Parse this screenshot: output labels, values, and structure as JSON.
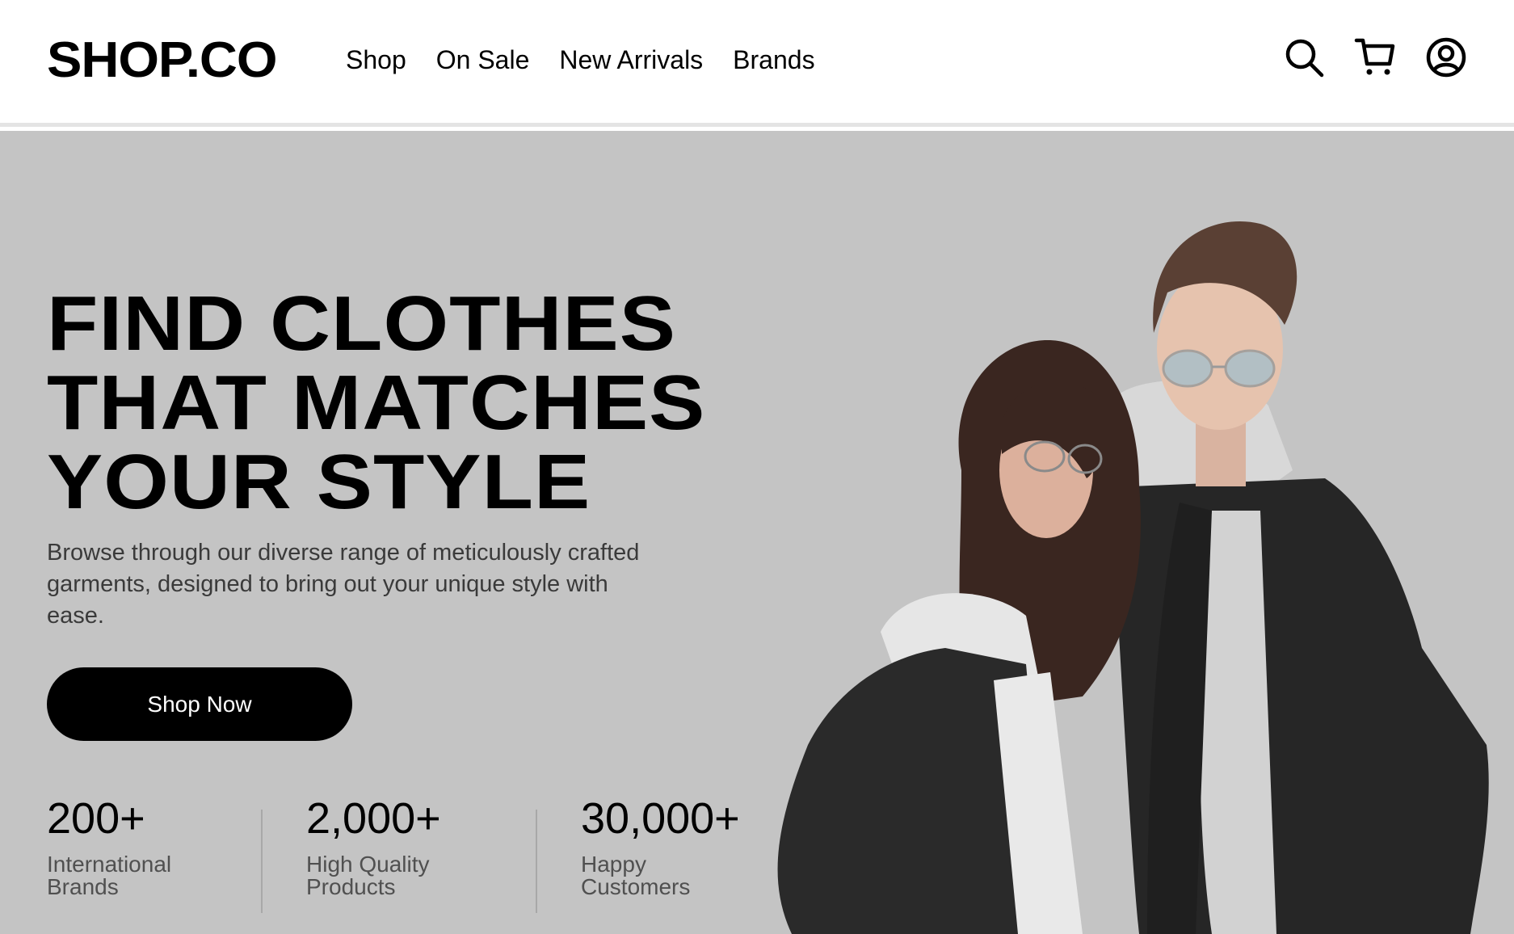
{
  "header": {
    "logo": "SHOP.CO",
    "nav": [
      "Shop",
      "On Sale",
      "New Arrivals",
      "Brands"
    ],
    "icons": [
      "search-icon",
      "cart-icon",
      "account-icon"
    ]
  },
  "hero": {
    "title_lines": [
      "FIND CLOTHES",
      "THAT MATCHES",
      "YOUR STYLE"
    ],
    "description_lines": [
      "Browse through our diverse range of meticulously crafted",
      "garments, designed to bring out your unique style with",
      "ease."
    ],
    "cta": "Shop Now",
    "stats": [
      {
        "value": "200+",
        "label_lines": [
          "International",
          "Brands"
        ]
      },
      {
        "value": "2,000+",
        "label_lines": [
          "High Quality",
          "Products"
        ]
      },
      {
        "value": "30,000+",
        "label_lines": [
          "Happy",
          "Customers"
        ]
      }
    ],
    "image": "couple-in-denim-jackets-photo"
  },
  "colors": {
    "hero_background": "#c4c4c4",
    "button_background": "#000000",
    "button_text": "#ffffff",
    "text_primary": "#000000",
    "text_secondary": "#3a3a3a"
  }
}
